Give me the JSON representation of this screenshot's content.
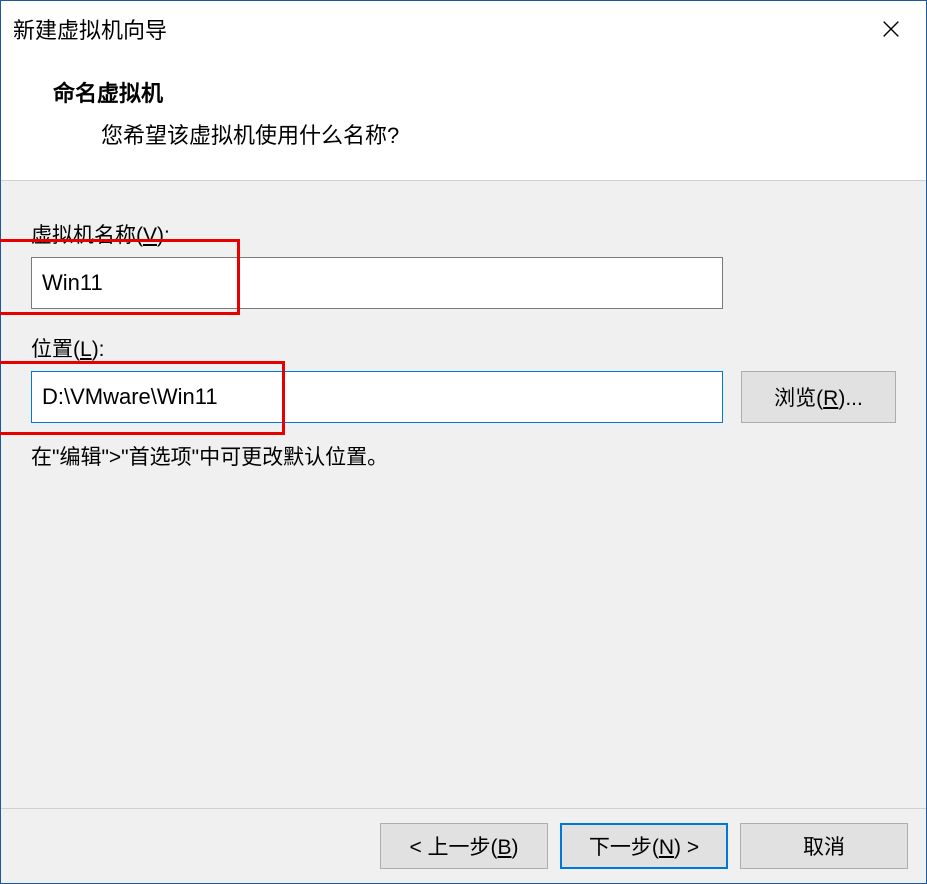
{
  "titlebar": {
    "title": "新建虚拟机向导"
  },
  "header": {
    "title": "命名虚拟机",
    "subtitle": "您希望该虚拟机使用什么名称?"
  },
  "form": {
    "vm_name": {
      "label_prefix": "虚拟机名称(",
      "label_hotkey": "V",
      "label_suffix": "):",
      "value": "Win11"
    },
    "location": {
      "label_prefix": "位置(",
      "label_hotkey": "L",
      "label_suffix": "):",
      "value": "D:\\VMware\\Win11"
    },
    "browse_btn": {
      "prefix": "浏览(",
      "hotkey": "R",
      "suffix": ")..."
    },
    "hint": "在\"编辑\">\"首选项\"中可更改默认位置。"
  },
  "footer": {
    "back": {
      "prefix": "< 上一步(",
      "hotkey": "B",
      "suffix": ")"
    },
    "next": {
      "prefix": "下一步(",
      "hotkey": "N",
      "suffix": ") >"
    },
    "cancel": "取消"
  }
}
